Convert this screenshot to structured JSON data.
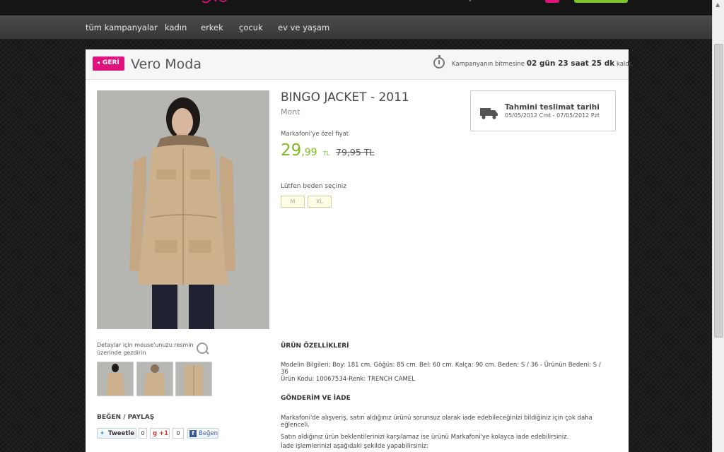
{
  "nav": {
    "items": [
      "tüm kampanyalar",
      "kadın",
      "erkek",
      "çocuk",
      "ev ve yaşam"
    ]
  },
  "header": {
    "back_label": "GERİ",
    "brand": "Vero Moda",
    "countdown_prefix": "Kampanyanın bitmesine",
    "countdown_value": "02 gün 23 saat 25 dk",
    "countdown_suffix": "kaldı."
  },
  "gallery": {
    "hint": "Detaylar için mouse'unuzu resmin üzerinde gezdirin",
    "thumb_count": 3
  },
  "share": {
    "title": "BEĞEN / PAYLAŞ",
    "tweet_label": "Tweetle",
    "tweet_count": "0",
    "gplus_label": "+1",
    "gplus_count": "0",
    "fb_label": "Beğen"
  },
  "product": {
    "title": "BINGO JACKET - 2011",
    "category": "Mont",
    "price_label": "Markafoni'ye özel fiyat",
    "price_int": "29",
    "price_dec": ",99",
    "currency": "TL",
    "old_price": "79,95 TL",
    "size_label": "Lütfen beden seçiniz",
    "sizes": [
      "M",
      "XL"
    ]
  },
  "delivery": {
    "title": "Tahmini teslimat tarihi",
    "dates": "05/05/2012 Cmt - 07/05/2012 Pzt"
  },
  "features": {
    "heading": "ÜRÜN ÖZELLİKLERİ",
    "model_info": "Modelin Bilgileri; Boy: 181 cm. Göğüs: 85 cm. Bel: 60 cm. Kalça: 90 cm. Beden: S / 36 - Ürünün Bedeni: S / 36",
    "code": "Ürün Kodu: 10067534-Renk: TRENCH CAMEL"
  },
  "returns": {
    "heading": "GÖNDERİM VE İADE",
    "line1": "Markafoni'de alışveriş, satın aldığınız ürünü sorunsuz olarak iade edebileceğinizi bildiğiniz için çok daha eğlenceli.",
    "line2": "Satın aldığınız ürün beklentilerinizi karşılamaz ise ürünü Markafoni'ye kolayca iade edebilirsiniz.",
    "line3": "İade işlemlerinizi aşağıdaki şekilde yapabilirsiniz:"
  },
  "colors": {
    "accent_pink": "#e0127b",
    "price_green": "#7fba1f",
    "nav_bg": "#3f3f3f"
  }
}
